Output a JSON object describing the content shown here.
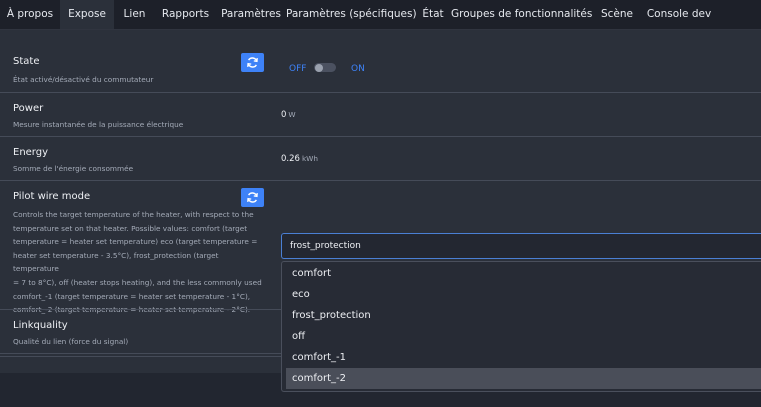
{
  "tabs": [
    "À propos",
    "Expose",
    "Lien",
    "Rapports",
    "Paramètres",
    "Paramètres (spécifiques)",
    "État",
    "Groupes de fonctionnalités",
    "Scène",
    "Console dev"
  ],
  "active_tab": "Expose",
  "rows": {
    "state": {
      "label": "State",
      "description": "État activé/désactivé du commutateur",
      "off_label": "OFF",
      "on_label": "ON",
      "value": "OFF"
    },
    "power": {
      "label": "Power",
      "description": "Mesure instantanée de la puissance électrique",
      "value": "0",
      "unit": "W"
    },
    "energy": {
      "label": "Energy",
      "description": "Somme de l'énergie consommée",
      "value": "0.26",
      "unit": "kWh"
    },
    "pilot": {
      "label": "Pilot wire mode",
      "description_lines": [
        "Controls the target temperature of the heater, with respect to the",
        "temperature set on that heater. Possible values: comfort (target",
        "temperature = heater set temperature) eco (target temperature =",
        "heater set temperature - 3.5°C), frost_protection (target temperature",
        "= 7 to 8°C), off (heater stops heating), and the less commonly used",
        "comfort_-1 (target temperature = heater set temperature - 1°C),",
        "comfort_-2 (target temperature = heater set temperature - 2°C)."
      ],
      "selected": "frost_protection",
      "options": [
        "comfort",
        "eco",
        "frost_protection",
        "off",
        "comfort_-1",
        "comfort_-2"
      ],
      "highlighted_option": "comfort_-2"
    },
    "linkquality": {
      "label": "Linkquality",
      "description": "Qualité du lien (force du signal)"
    }
  },
  "colors": {
    "accent": "#3e82f7",
    "background": "#222630",
    "card": "#2b303a"
  },
  "icons": {
    "refresh": "refresh-icon"
  }
}
